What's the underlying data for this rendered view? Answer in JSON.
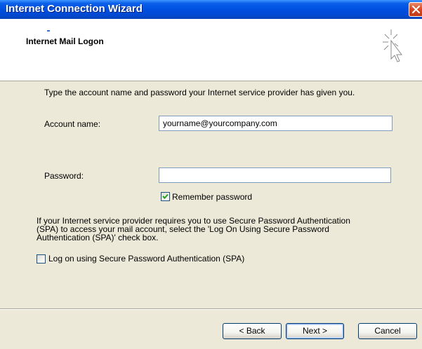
{
  "window": {
    "title": "Internet Connection Wizard"
  },
  "header": {
    "title": "Internet Mail Logon"
  },
  "content": {
    "instructions": "Type the account name and password your Internet service provider has given you.",
    "account_name_label": "Account name:",
    "account_name_value": "yourname@yourcompany.com",
    "password_label": "Password:",
    "password_value": "",
    "remember_password_label": "Remember password",
    "remember_password_checked": true,
    "spa_text_1": "If your Internet service provider requires you to use Secure Password Authentication",
    "spa_text_2": "(SPA) to access your mail account, select the 'Log On Using Secure Password",
    "spa_text_3": "Authentication (SPA)' check box.",
    "spa_checkbox_label": "Log on using Secure Password Authentication (SPA)",
    "spa_checked": false
  },
  "buttons": {
    "back_label": "< Back",
    "next_label": "Next >",
    "cancel_label": "Cancel"
  },
  "icons": {
    "close": "close-icon",
    "wizard": "wizard-cursor-icon",
    "check": "checkmark-icon"
  },
  "colors": {
    "titlebar": "#0050e0",
    "dialog_bg": "#ece9d8",
    "header_bg": "#ffffff",
    "close_button": "#d9461f",
    "input_border": "#7f9db9",
    "checkmark": "#21a121"
  }
}
